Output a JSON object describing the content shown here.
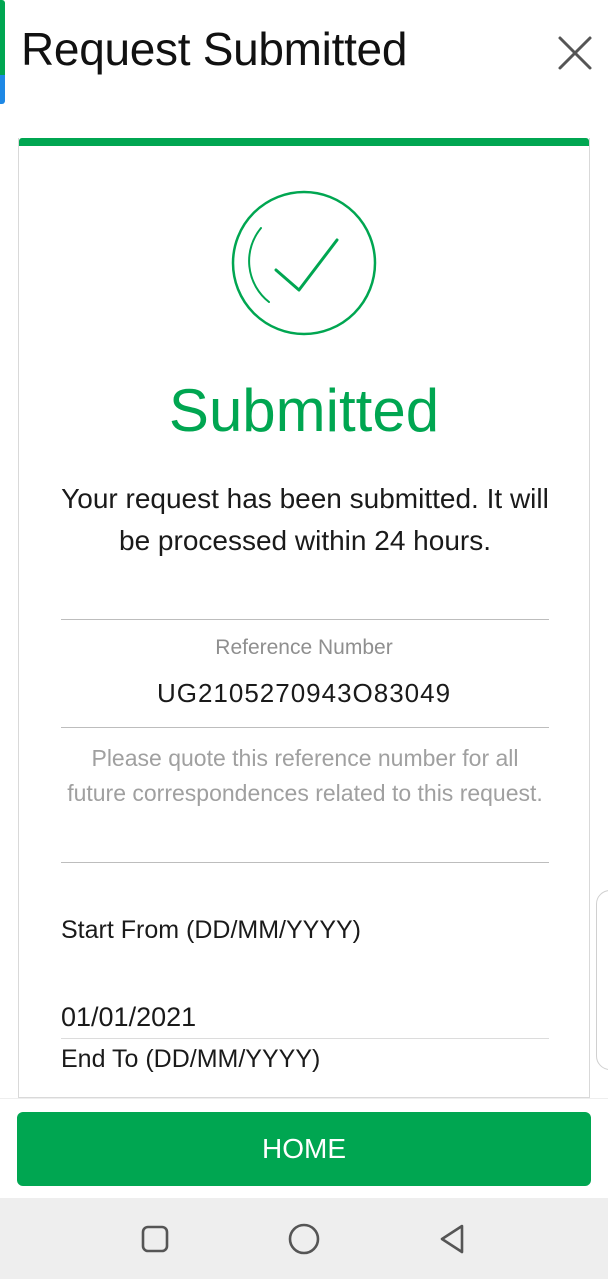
{
  "header": {
    "title": "Request Submitted",
    "close_icon": "close-icon"
  },
  "status": {
    "icon": "check-circle-icon",
    "title": "Submitted"
  },
  "message": "Your request has been submitted. It will be processed within 24 hours.",
  "reference": {
    "label": "Reference Number",
    "value": "UG2105270943O83049",
    "note": "Please quote this reference number for all future correspondences related to this request."
  },
  "fields": {
    "start_label": "Start From (DD/MM/YYYY)",
    "start_value": "01/01/2021",
    "end_label": "End To (DD/MM/YYYY)"
  },
  "footer": {
    "home_label": "HOME"
  },
  "nav": {
    "recent_icon": "square-icon",
    "home_icon": "circle-icon",
    "back_icon": "triangle-back-icon"
  },
  "colors": {
    "accent": "#00a651",
    "secondary_accent": "#1e88e5",
    "muted_text": "#8f8f8f"
  }
}
